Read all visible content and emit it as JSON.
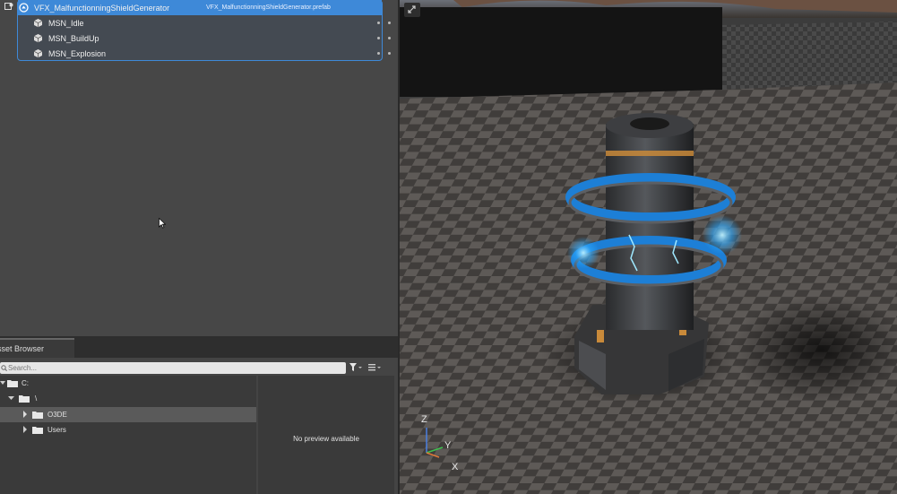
{
  "entity_outliner": {
    "prefab": {
      "name": "VFX_MalfunctionningShieldGenerator",
      "file": "VFX_MalfunctionningShieldGenerator.prefab"
    },
    "children": [
      {
        "name": "MSN_Idle"
      },
      {
        "name": "MSN_BuildUp"
      },
      {
        "name": "MSN_Explosion"
      }
    ]
  },
  "asset_browser": {
    "tab_label": "sset Browser",
    "search_placeholder": "Search...",
    "tree": [
      {
        "label": "C:"
      },
      {
        "label": "\\"
      },
      {
        "label": "O3DE"
      },
      {
        "label": "Users"
      }
    ],
    "preview_text": "No preview available"
  },
  "viewport": {
    "axis_labels": {
      "z": "Z",
      "y": "Y",
      "x": "X"
    }
  },
  "colors": {
    "selection": "#3e89d8",
    "glow": "#2aa8ff"
  }
}
